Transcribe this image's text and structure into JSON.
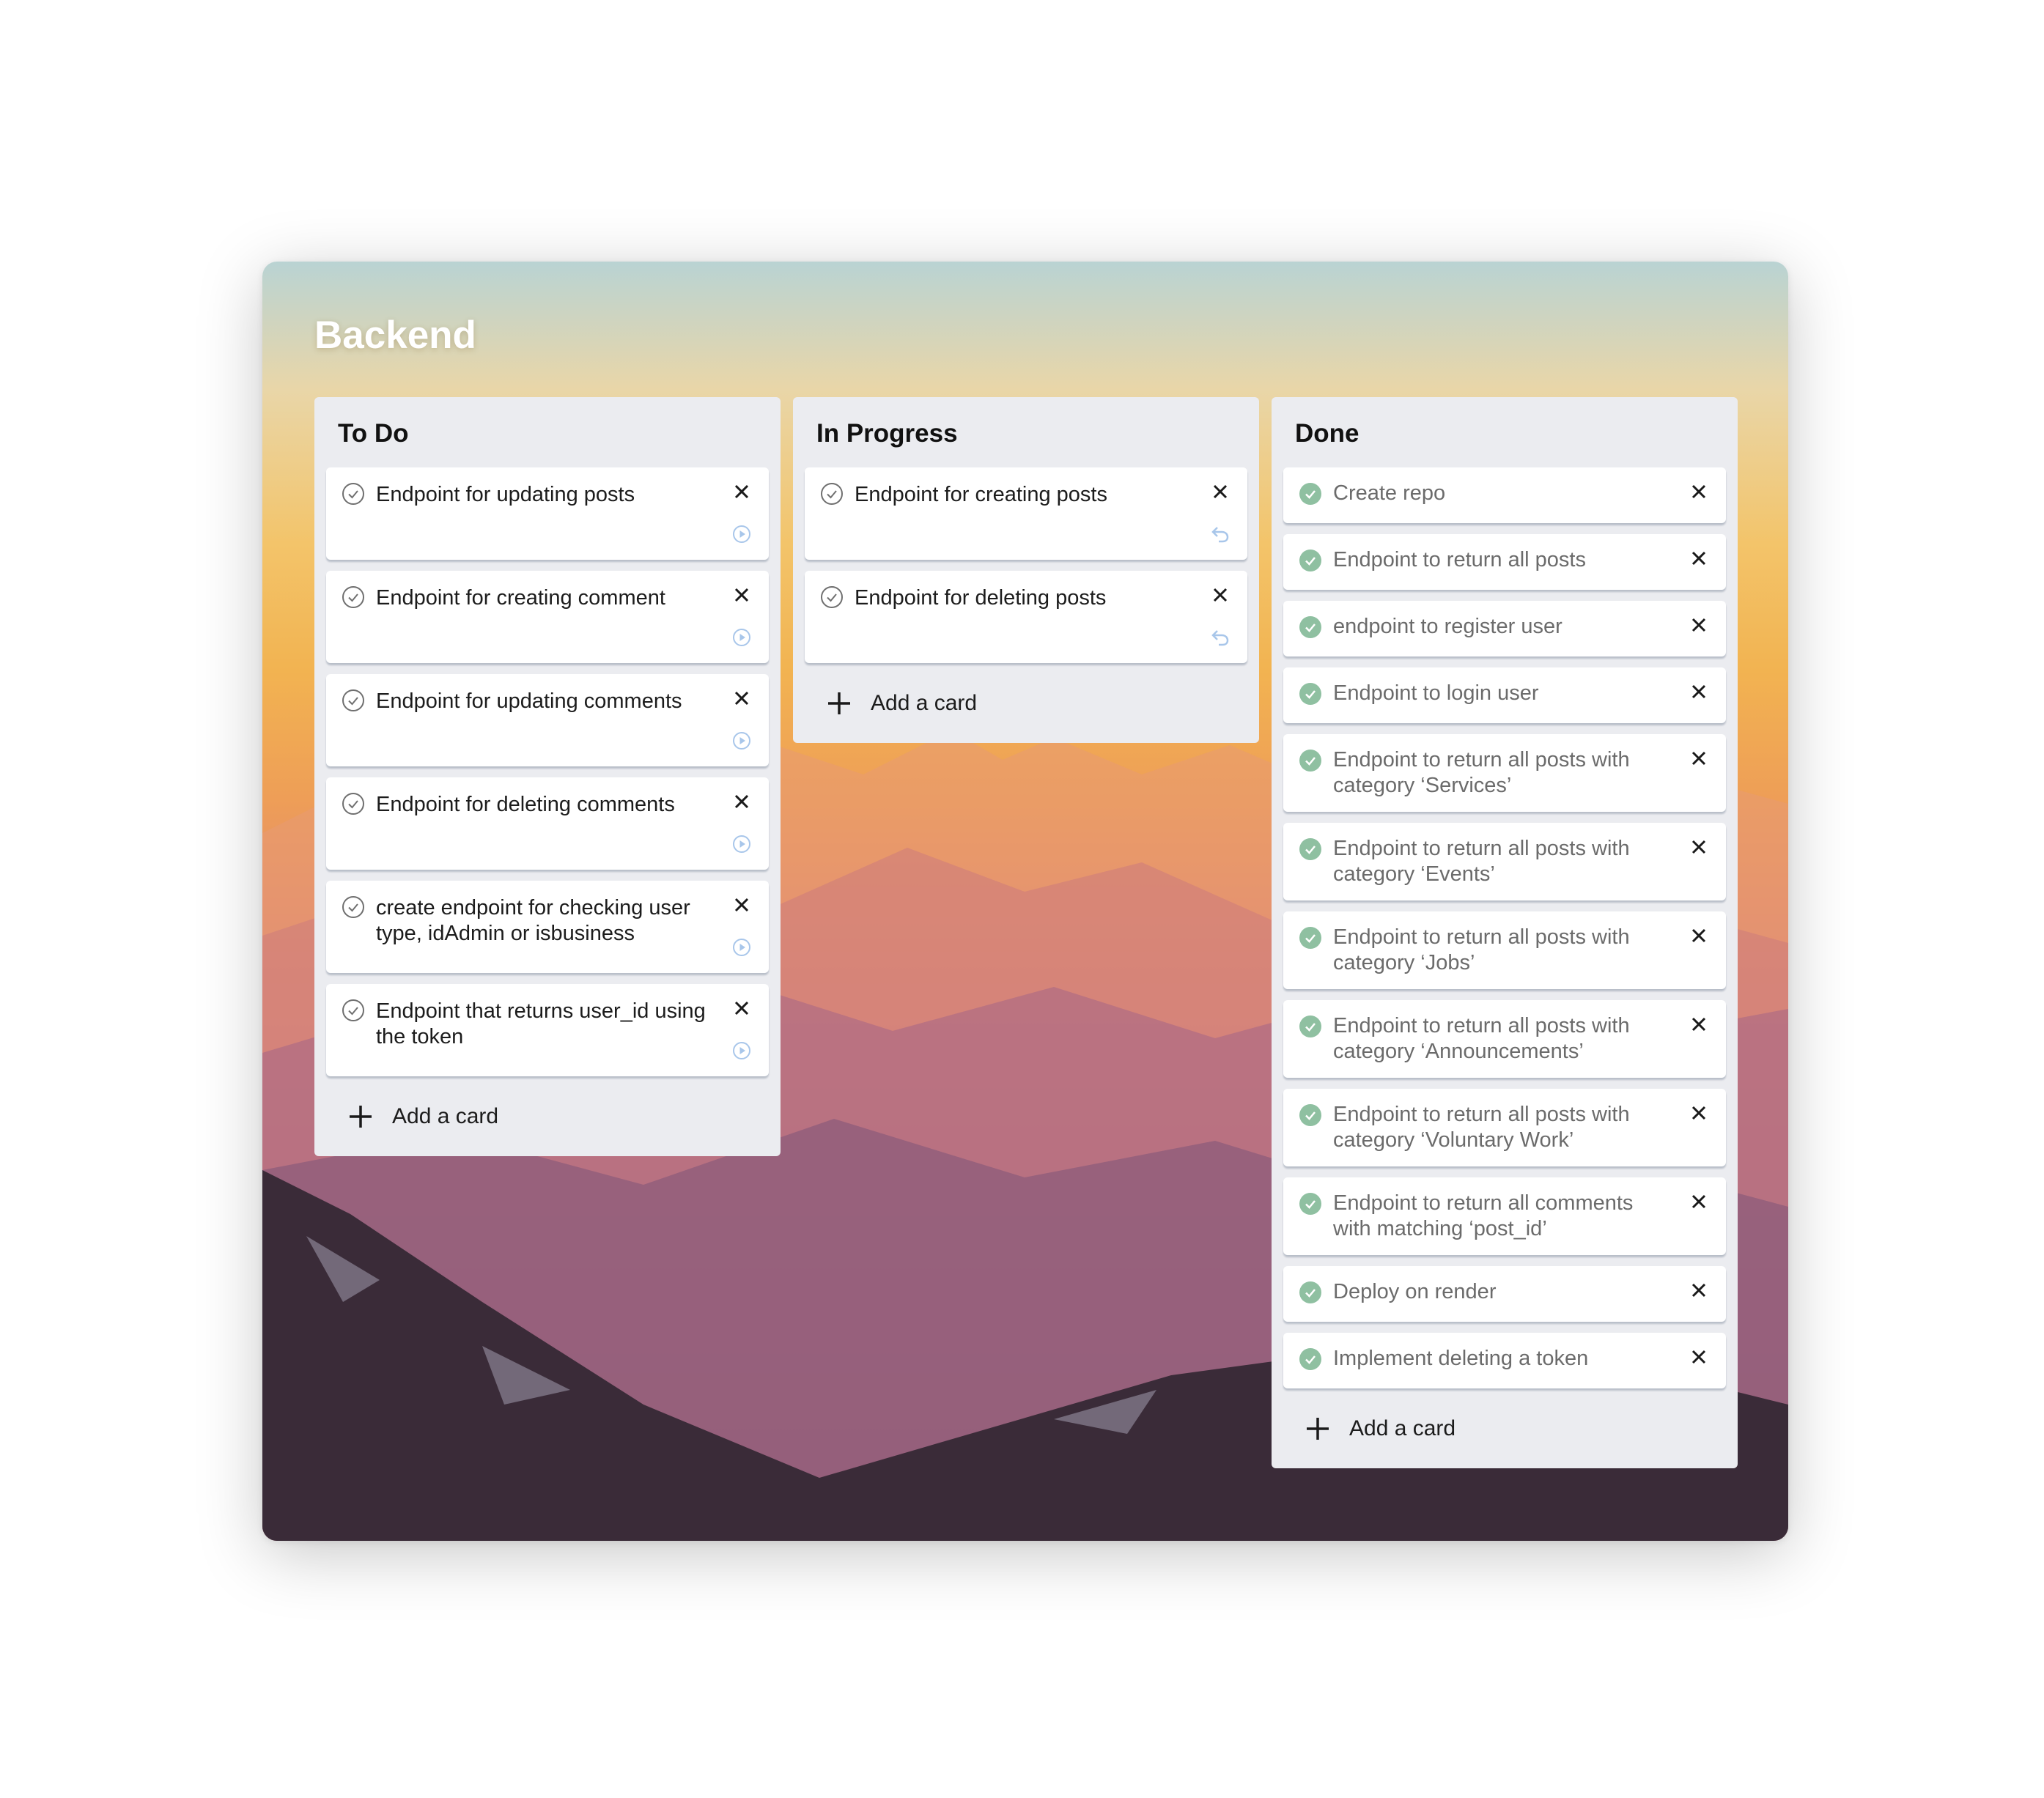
{
  "board": {
    "title": "Backend"
  },
  "colors": {
    "list_bg": "#ebecf0",
    "check_done": "#8fc0a1",
    "check_todo": "#6f6f6f",
    "action_icon": "#a8c6ea"
  },
  "lists": [
    {
      "title": "To Do",
      "cards": [
        {
          "text": "Endpoint for updating posts",
          "status": "todo",
          "action_icon": "play-circle-icon"
        },
        {
          "text": " Endpoint for creating comment",
          "status": "todo",
          "action_icon": "play-circle-icon"
        },
        {
          "text": " Endpoint for updating comments",
          "status": "todo",
          "action_icon": "play-circle-icon"
        },
        {
          "text": " Endpoint for deleting comments",
          "status": "todo",
          "action_icon": "play-circle-icon"
        },
        {
          "text": " create endpoint for checking user type, idAdmin or isbusiness",
          "status": "todo",
          "action_icon": "play-circle-icon"
        },
        {
          "text": " Endpoint that returns user_id using the token",
          "status": "todo",
          "action_icon": "play-circle-icon"
        }
      ],
      "add_label": "Add a card"
    },
    {
      "title": "In Progress",
      "cards": [
        {
          "text": "Endpoint for creating posts",
          "status": "in-progress",
          "action_icon": "undo-icon"
        },
        {
          "text": "Endpoint for deleting posts",
          "status": "in-progress",
          "action_icon": "undo-icon"
        }
      ],
      "add_label": "Add a card"
    },
    {
      "title": "Done",
      "cards": [
        {
          "text": "Create repo",
          "status": "done"
        },
        {
          "text": "Endpoint to return all posts",
          "status": "done"
        },
        {
          "text": " endpoint to register user",
          "status": "done"
        },
        {
          "text": " Endpoint to login user",
          "status": "done"
        },
        {
          "text": "Endpoint to return all posts with category ‘Services’",
          "status": "done"
        },
        {
          "text": " Endpoint to return all posts with category  ‘Events’",
          "status": "done"
        },
        {
          "text": " Endpoint to return all posts with category ‘Jobs’",
          "status": "done"
        },
        {
          "text": " Endpoint to return all posts with category ‘Announcements’",
          "status": "done"
        },
        {
          "text": "Endpoint to return all posts with category ‘Voluntary Work’",
          "status": "done"
        },
        {
          "text": " Endpoint to return all comments with matching ‘post_id’",
          "status": "done"
        },
        {
          "text": "Deploy on render",
          "status": "done"
        },
        {
          "text": " Implement deleting a token",
          "status": "done"
        }
      ],
      "add_label": "Add a card"
    }
  ]
}
